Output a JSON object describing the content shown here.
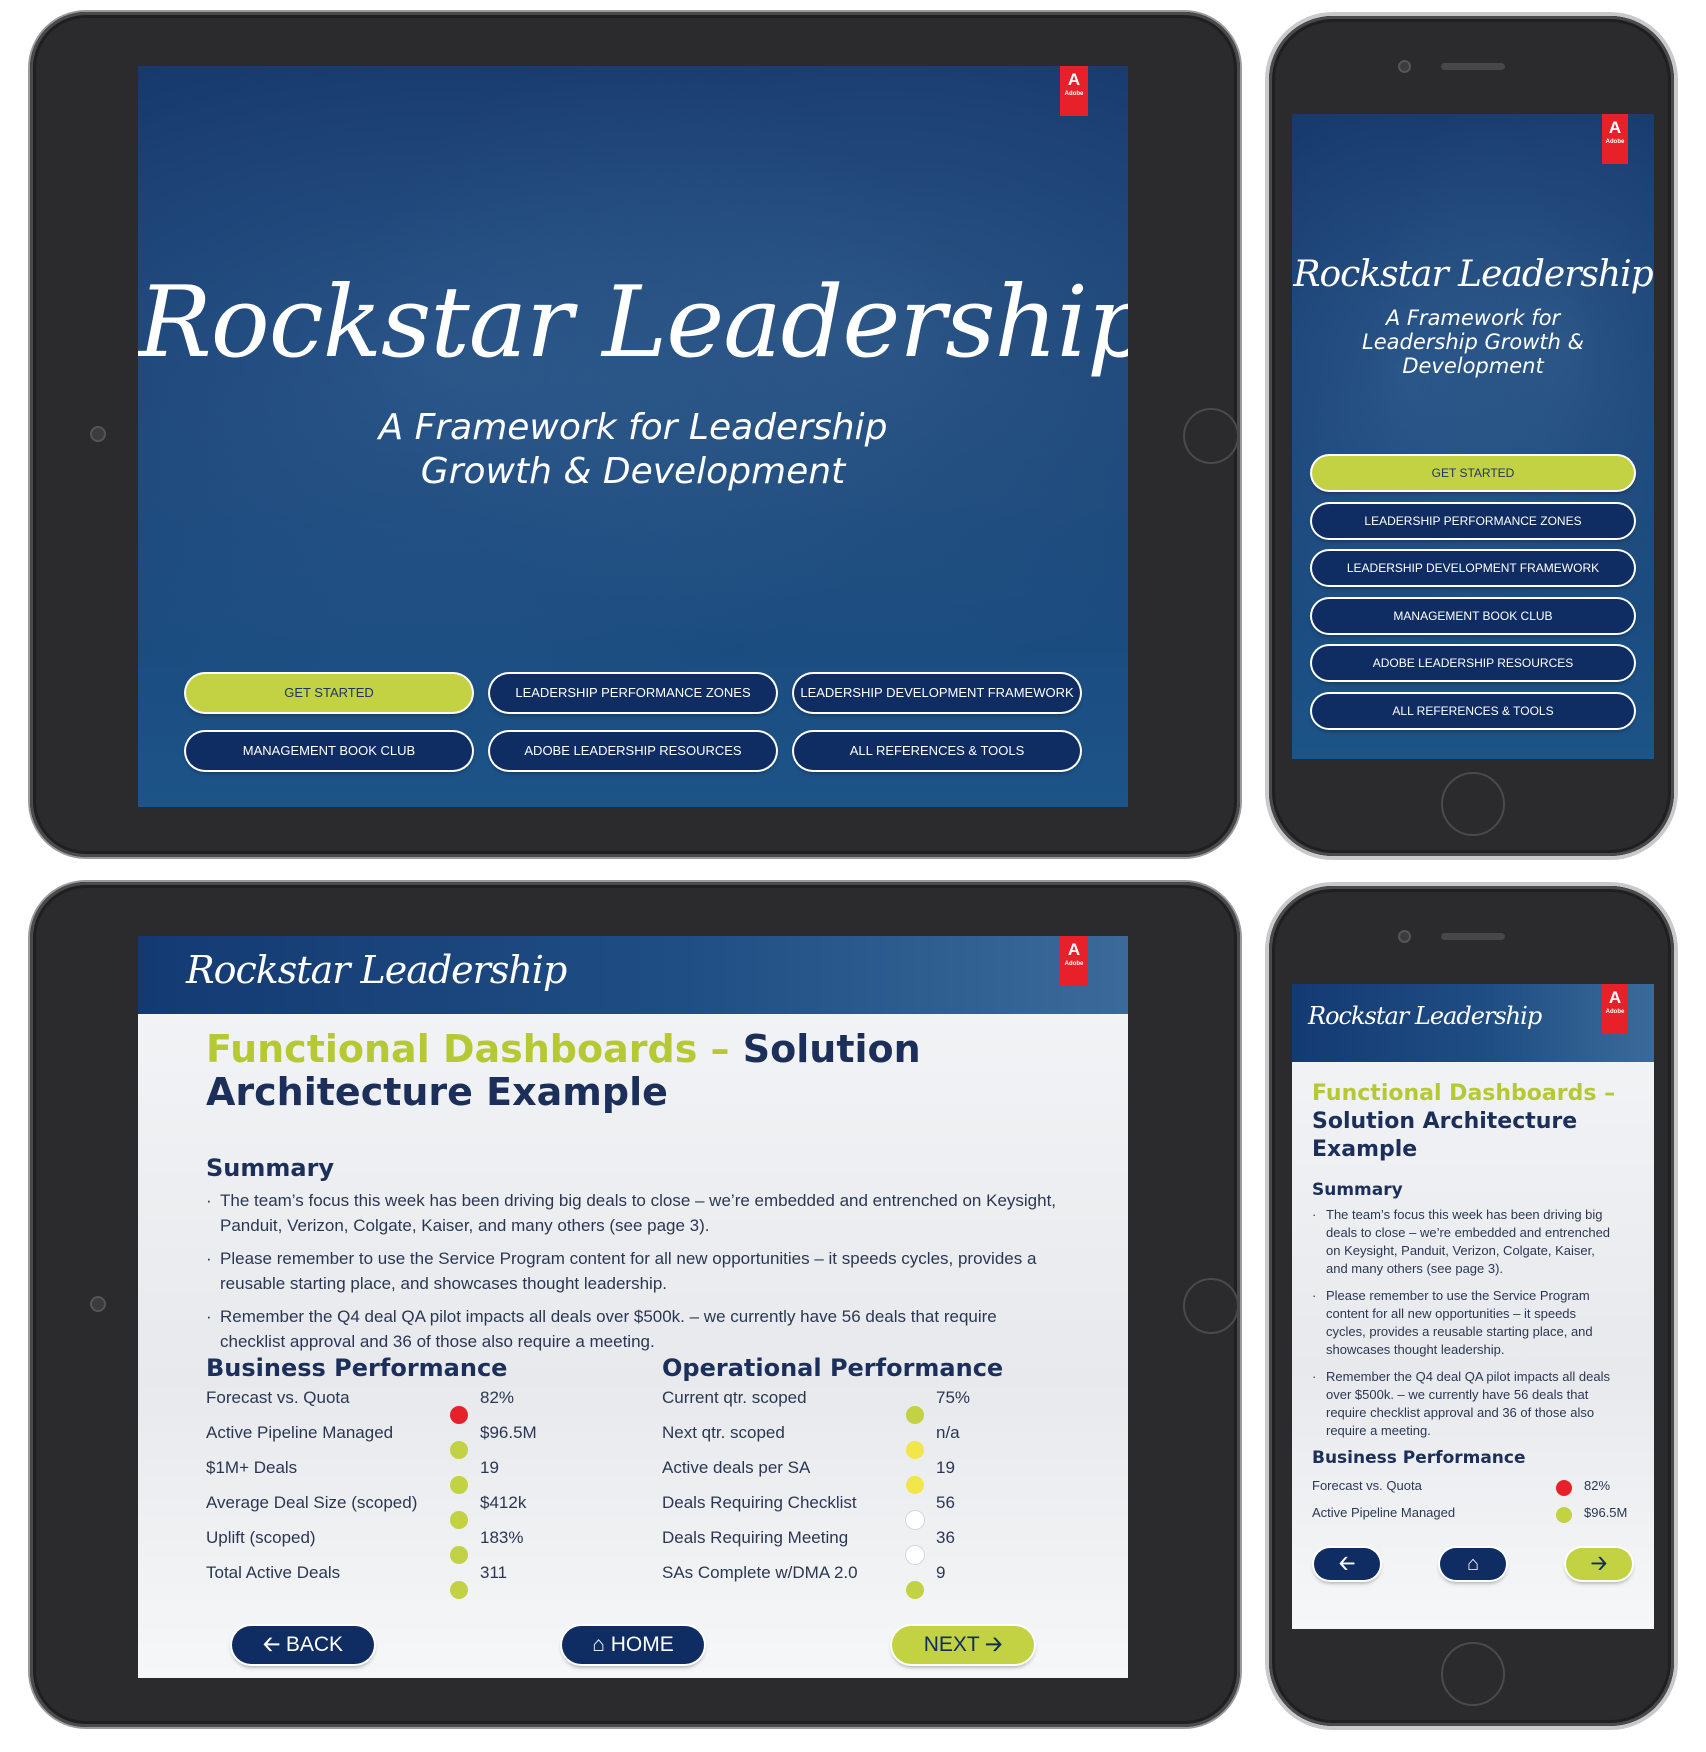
{
  "brand": {
    "title": "Rockstar Leadership",
    "subtitle_tablet_1": "A Framework for Leadership",
    "subtitle_tablet_2": "Growth & Development",
    "subtitle_phone_1": "A Framework for",
    "subtitle_phone_2": "Leadership Growth &",
    "subtitle_phone_3": "Development",
    "adobe_logo": "A",
    "adobe_word": "Adobe"
  },
  "menu": {
    "get_started": "GET STARTED",
    "performance_zones": "LEADERSHIP PERFORMANCE ZONES",
    "development_framework": "LEADERSHIP DEVELOPMENT FRAMEWORK",
    "book_club": "MANAGEMENT BOOK CLUB",
    "resources": "ADOBE LEADERSHIP RESOURCES",
    "references": "ALL REFERENCES & TOOLS"
  },
  "page": {
    "title_green": "Functional Dashboards –",
    "title_dark_tablet": "Solution",
    "title_dark_tablet_2": "Architecture Example",
    "title_dark_phone_1": "Solution Architecture",
    "title_dark_phone_2": "Example",
    "summary_heading": "Summary",
    "bullets": [
      "The team’s focus this week has been driving big deals to close – we’re embedded and entrenched on Keysight, Panduit, Verizon, Colgate, Kaiser, and many others (see page 3).",
      "Please remember to use the Service Program content for all new opportunities – it speeds cycles, provides a reusable starting place, and showcases thought leadership.",
      "Remember the Q4 deal QA pilot impacts all deals over $500k. – we currently have 56 deals that require checklist approval and 36 of those also require a meeting."
    ],
    "business_heading": "Business Performance",
    "operational_heading": "Operational Performance",
    "business_metrics": [
      {
        "label": "Forecast vs. Quota",
        "value": "82%",
        "status": "red"
      },
      {
        "label": "Active Pipeline Managed",
        "value": "$96.5M",
        "status": "green"
      },
      {
        "label": "$1M+ Deals",
        "value": "19",
        "status": "green"
      },
      {
        "label": "Average Deal Size (scoped)",
        "value": "$412k",
        "status": "green"
      },
      {
        "label": "Uplift (scoped)",
        "value": "183%",
        "status": "green"
      },
      {
        "label": "Total Active Deals",
        "value": "311",
        "status": "green"
      }
    ],
    "operational_metrics": [
      {
        "label": "Current qtr. scoped",
        "value": "75%",
        "status": "green"
      },
      {
        "label": "Next qtr. scoped",
        "value": "n/a",
        "status": "yellow"
      },
      {
        "label": "Active deals per SA",
        "value": "19",
        "status": "yellow"
      },
      {
        "label": "Deals Requiring Checklist",
        "value": "56",
        "status": "white"
      },
      {
        "label": "Deals Requiring Meeting",
        "value": "36",
        "status": "white"
      },
      {
        "label": "SAs Complete w/DMA 2.0",
        "value": "9",
        "status": "green"
      }
    ],
    "nav": {
      "back": "BACK",
      "home": "HOME",
      "next": "NEXT"
    }
  },
  "icons": {
    "back": "arrow-left-icon",
    "home": "home-icon",
    "next": "arrow-right-icon"
  },
  "colors": {
    "navy": "#0f2c63",
    "lime": "#c2d243",
    "red": "#e8202a",
    "yellow": "#f1e64a",
    "white": "#ffffff"
  }
}
